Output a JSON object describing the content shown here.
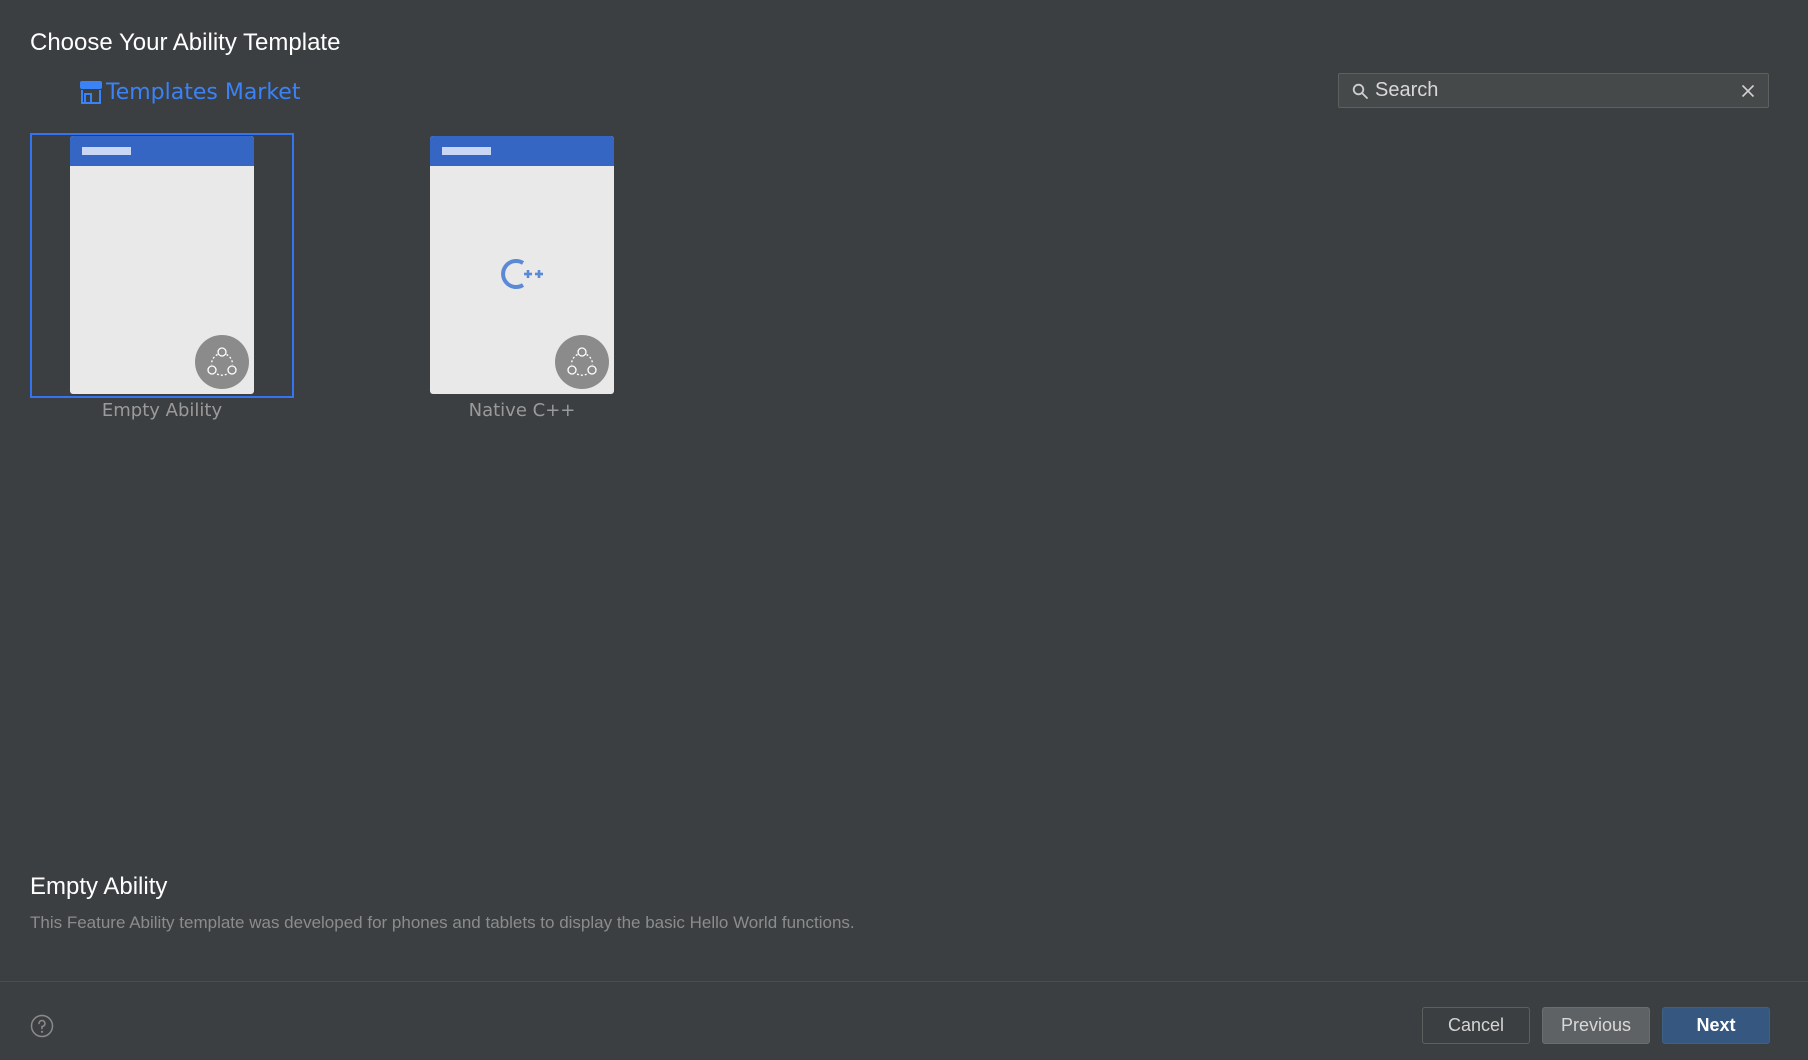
{
  "dialog": {
    "title": "Choose Your Ability Template"
  },
  "market": {
    "label": "Templates Market",
    "icon": "store-icon",
    "color": "#3b82f6"
  },
  "search": {
    "placeholder": "Search",
    "value": "",
    "icon": "search-icon",
    "clear_icon": "close-icon"
  },
  "templates": [
    {
      "label": "Empty Ability",
      "selected": true,
      "badge_icon": "ability-badge-icon"
    },
    {
      "label": "Native C++",
      "selected": false,
      "glyph_icon": "cpp-icon",
      "badge_icon": "ability-badge-icon"
    }
  ],
  "description": {
    "title": "Empty Ability",
    "text": "This Feature Ability template was developed for phones and tablets to display the basic Hello World functions."
  },
  "footer": {
    "help_icon": "help-icon",
    "cancel_label": "Cancel",
    "previous_label": "Previous",
    "next_label": "Next"
  },
  "colors": {
    "background": "#3c3f41",
    "selection_border": "#3574f0",
    "card_header": "#3666c4",
    "primary_button": "#365880"
  }
}
